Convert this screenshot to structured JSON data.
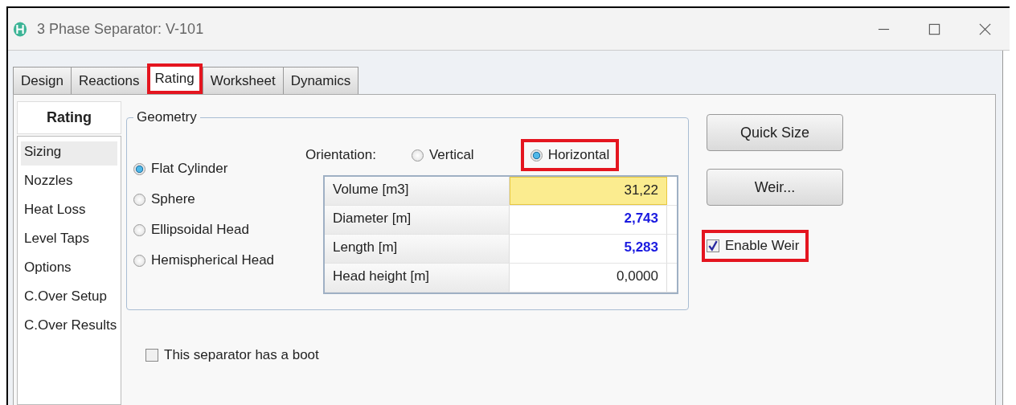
{
  "window": {
    "title": "3 Phase Separator: V-101"
  },
  "tabs": [
    {
      "label": "Design",
      "selected": false,
      "highlighted": false
    },
    {
      "label": "Reactions",
      "selected": false,
      "highlighted": false
    },
    {
      "label": "Rating",
      "selected": true,
      "highlighted": true
    },
    {
      "label": "Worksheet",
      "selected": false,
      "highlighted": false
    },
    {
      "label": "Dynamics",
      "selected": false,
      "highlighted": false
    }
  ],
  "sidebar": {
    "header": "Rating",
    "items": [
      {
        "label": "Sizing",
        "selected": true
      },
      {
        "label": "Nozzles",
        "selected": false
      },
      {
        "label": "Heat Loss",
        "selected": false
      },
      {
        "label": "Level Taps",
        "selected": false
      },
      {
        "label": "Options",
        "selected": false
      },
      {
        "label": "C.Over Setup",
        "selected": false
      },
      {
        "label": "C.Over Results",
        "selected": false
      }
    ]
  },
  "geometry": {
    "title": "Geometry",
    "shapes": [
      {
        "label": "Flat Cylinder",
        "selected": true
      },
      {
        "label": "Sphere",
        "selected": false
      },
      {
        "label": "Ellipsoidal Head",
        "selected": false
      },
      {
        "label": "Hemispherical Head",
        "selected": false
      }
    ],
    "orientation_label": "Orientation:",
    "orientations": [
      {
        "label": "Vertical",
        "selected": false,
        "highlighted": false
      },
      {
        "label": "Horizontal",
        "selected": true,
        "highlighted": true
      }
    ],
    "table": [
      {
        "label": "Volume [m3]",
        "value": "31,22",
        "selected": true,
        "kind": "plain"
      },
      {
        "label": "Diameter [m]",
        "value": "2,743",
        "selected": false,
        "kind": "calculated"
      },
      {
        "label": "Length [m]",
        "value": "5,283",
        "selected": false,
        "kind": "calculated"
      },
      {
        "label": "Head height [m]",
        "value": "0,0000",
        "selected": false,
        "kind": "plain"
      }
    ]
  },
  "buttons": [
    "Quick Size",
    "Weir..."
  ],
  "enable_weir": {
    "label": "Enable Weir",
    "checked": true,
    "highlighted": true
  },
  "boot": {
    "label": "This separator has a boot",
    "checked": false
  }
}
